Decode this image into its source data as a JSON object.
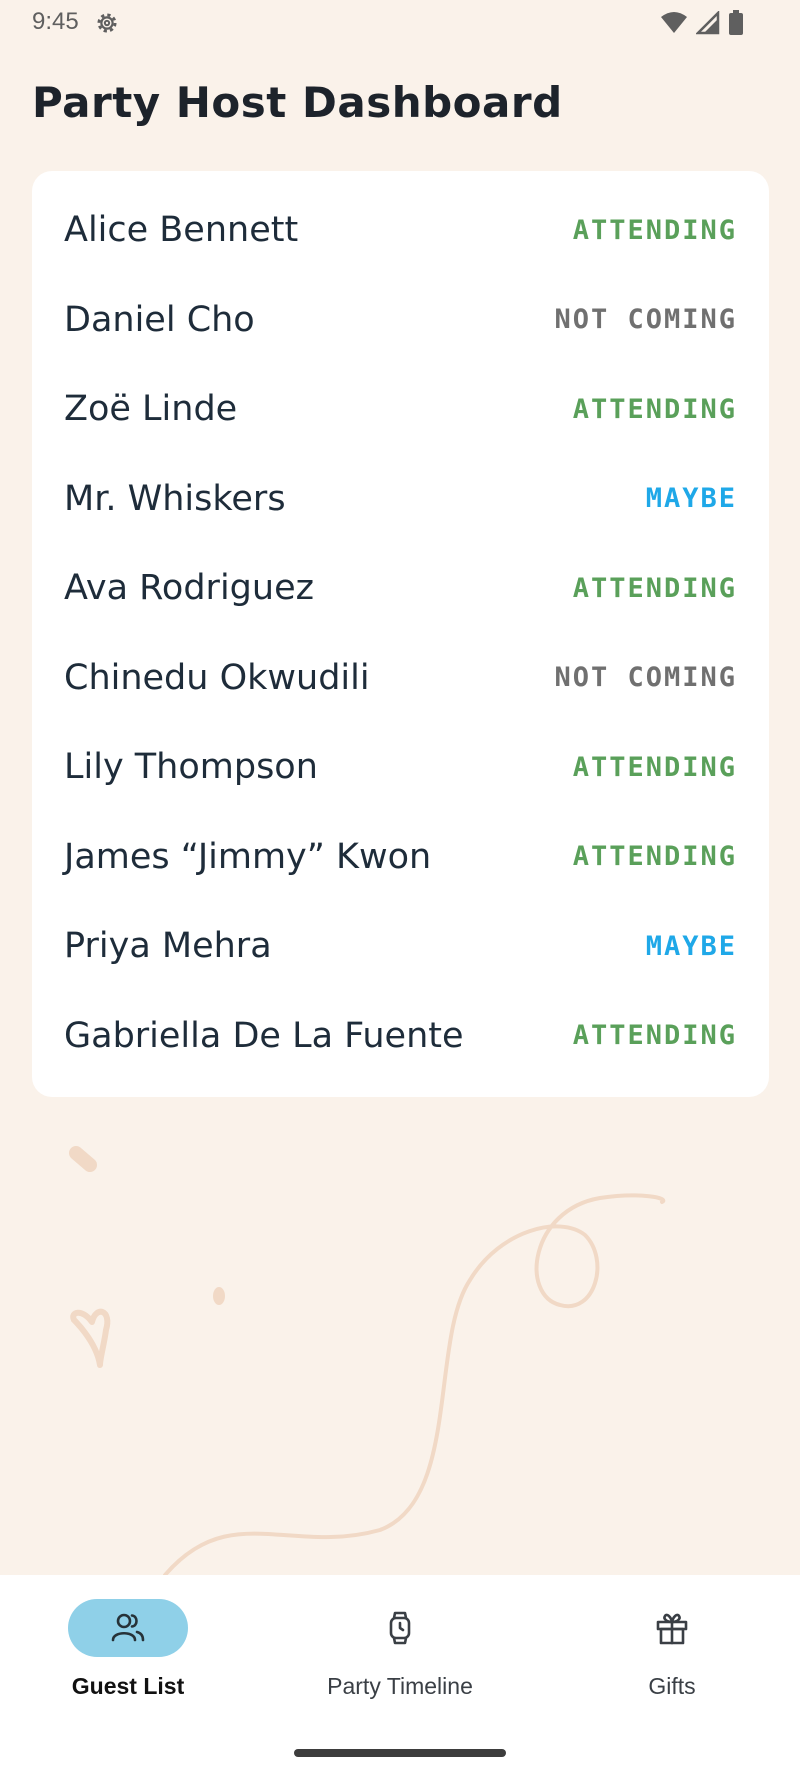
{
  "status_bar": {
    "time": "9:45",
    "icons": [
      "settings-gear-icon",
      "wifi-icon",
      "signal-icon",
      "battery-icon"
    ]
  },
  "header": {
    "title": "Party Host Dashboard"
  },
  "guests": [
    {
      "name": "Alice Bennett",
      "status": "ATTENDING",
      "status_color": "#5aa05a"
    },
    {
      "name": "Daniel Cho",
      "status": "NOT COMING",
      "status_color": "#707070"
    },
    {
      "name": "Zoë Linde",
      "status": "ATTENDING",
      "status_color": "#5aa05a"
    },
    {
      "name": "Mr. Whiskers",
      "status": "MAYBE",
      "status_color": "#1fa8e8"
    },
    {
      "name": "Ava Rodriguez",
      "status": "ATTENDING",
      "status_color": "#5aa05a"
    },
    {
      "name": "Chinedu Okwudili",
      "status": "NOT COMING",
      "status_color": "#707070"
    },
    {
      "name": "Lily Thompson",
      "status": "ATTENDING",
      "status_color": "#5aa05a"
    },
    {
      "name": "James “Jimmy” Kwon",
      "status": "ATTENDING",
      "status_color": "#5aa05a"
    },
    {
      "name": "Priya Mehra",
      "status": "MAYBE",
      "status_color": "#1fa8e8"
    },
    {
      "name": "Gabriella De La Fuente",
      "status": "ATTENDING",
      "status_color": "#5aa05a"
    }
  ],
  "bottom_nav": {
    "items": [
      {
        "label": "Guest List",
        "icon": "people-icon",
        "active": true
      },
      {
        "label": "Party Timeline",
        "icon": "watch-icon",
        "active": false
      },
      {
        "label": "Gifts",
        "icon": "gift-icon",
        "active": false
      }
    ]
  },
  "colors": {
    "background": "#faf2ea",
    "card": "#ffffff",
    "active_pill": "#8fd0e8",
    "attending": "#5aa05a",
    "not_coming": "#707070",
    "maybe": "#1fa8e8"
  }
}
